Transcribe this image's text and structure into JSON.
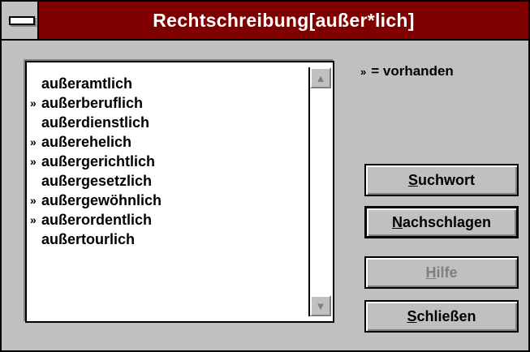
{
  "window": {
    "title": "Rechtschreibung[außer*lich]"
  },
  "legend": {
    "marker": "»",
    "text": "= vorhanden"
  },
  "list": {
    "items": [
      {
        "text": "außeramtlich",
        "marked": ""
      },
      {
        "text": "außerberuflich",
        "marked": "»"
      },
      {
        "text": "außerdienstlich",
        "marked": ""
      },
      {
        "text": "außerehelich",
        "marked": "»"
      },
      {
        "text": "außergerichtlich",
        "marked": "»"
      },
      {
        "text": "außergesetzlich",
        "marked": ""
      },
      {
        "text": "außergewöhnlich",
        "marked": "»"
      },
      {
        "text": "außerordentlich",
        "marked": "»"
      },
      {
        "text": "außertourlich",
        "marked": ""
      }
    ]
  },
  "buttons": {
    "suchwort": {
      "accel": "S",
      "rest": "uchwort"
    },
    "nachschlagen": {
      "accel": "N",
      "rest": "achschlagen"
    },
    "hilfe": {
      "accel": "H",
      "rest": "ilfe"
    },
    "schliessen": {
      "accel": "S",
      "rest": "chließen"
    }
  },
  "icons": {
    "sysmenu": "system-menu-icon",
    "scroll_up": "scroll-up-arrow-icon",
    "scroll_down": "scroll-down-arrow-icon"
  }
}
